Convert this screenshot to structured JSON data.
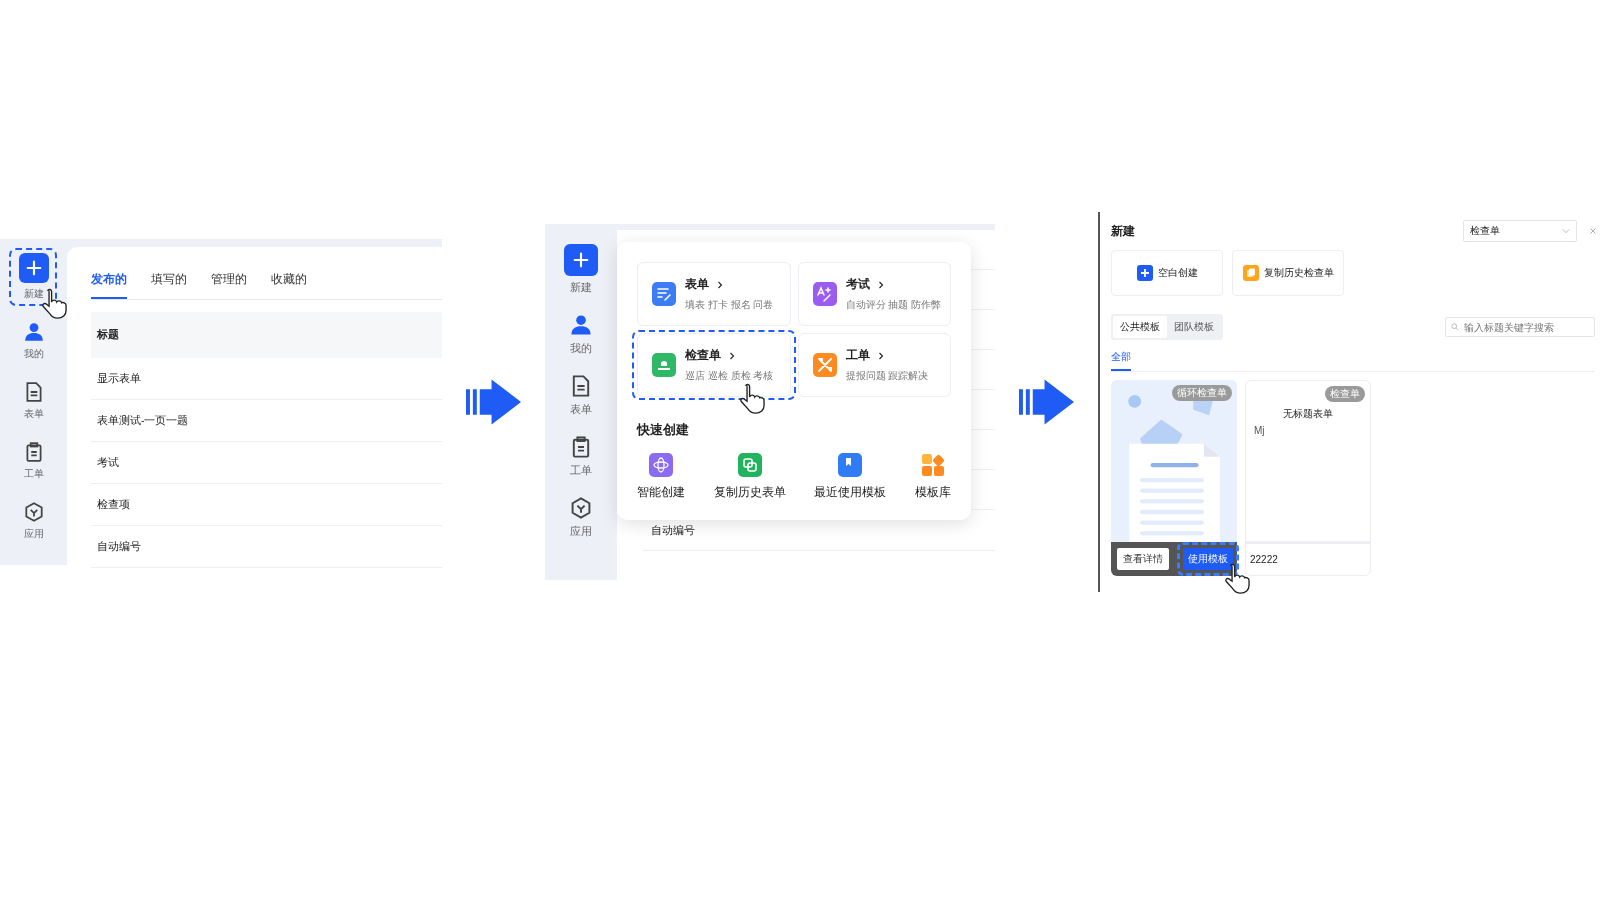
{
  "list_screen": {
    "sidebar": [
      {
        "label": "新建",
        "highlighted": true
      },
      {
        "label": "我的"
      },
      {
        "label": "表单"
      },
      {
        "label": "工单"
      },
      {
        "label": "应用"
      }
    ],
    "tabs": [
      {
        "label": "发布的",
        "selected": true
      },
      {
        "label": "填写的",
        "selected": false
      },
      {
        "label": "管理的",
        "selected": false
      },
      {
        "label": "收藏的",
        "selected": false
      }
    ],
    "rows": [
      {
        "text": "标题",
        "header": true
      },
      {
        "text": "显示表单",
        "header": false
      },
      {
        "text": "表单测试-一页一题",
        "header": false
      },
      {
        "text": "考试",
        "header": false
      },
      {
        "text": "检查项",
        "header": false
      },
      {
        "text": "自动编号",
        "header": false
      }
    ]
  },
  "menu_screen": {
    "sidebar": [
      {
        "label": "新建"
      },
      {
        "label": "我的"
      },
      {
        "label": "表单"
      },
      {
        "label": "工单"
      },
      {
        "label": "应用"
      }
    ],
    "popup": {
      "cards": [
        {
          "title": "表单",
          "subtitle": "填表 打卡 报名 问卷",
          "highlighted": false
        },
        {
          "title": "考试",
          "subtitle": "自动评分 抽题 防作弊",
          "highlighted": false
        },
        {
          "title": "检查单",
          "subtitle": "巡店 巡检 质检 考核",
          "highlighted": true
        },
        {
          "title": "工单",
          "subtitle": "提报问题 跟踪解决",
          "highlighted": false
        }
      ],
      "quick_title": "快速创建",
      "quick_items": [
        {
          "label": "智能创建"
        },
        {
          "label": "复制历史表单"
        },
        {
          "label": "最近使用模板"
        },
        {
          "label": "模板库"
        }
      ]
    },
    "rows": [
      {
        "text": "自动编号"
      }
    ]
  },
  "dialog_screen": {
    "title": "新建",
    "type_select": "检查单",
    "create_options": [
      {
        "label": "空白创建"
      },
      {
        "label": "复制历史检查单"
      }
    ],
    "template_tabs": [
      {
        "label": "公共模板",
        "selected": true
      },
      {
        "label": "团队模板",
        "selected": false
      }
    ],
    "search": {
      "placeholder": "输入标题关键字搜索"
    },
    "category_tabs": [
      {
        "label": "全部",
        "selected": true
      }
    ],
    "templates": [
      {
        "kind": "illustrated",
        "badge": "循环检查单",
        "buttons": [
          {
            "label": "查看详情",
            "highlighted": false
          },
          {
            "label": "使用模板",
            "highlighted": true
          }
        ]
      },
      {
        "kind": "form",
        "badge": "检查单",
        "title": "无标题表单",
        "note": "Mj",
        "name": "22222"
      }
    ]
  }
}
